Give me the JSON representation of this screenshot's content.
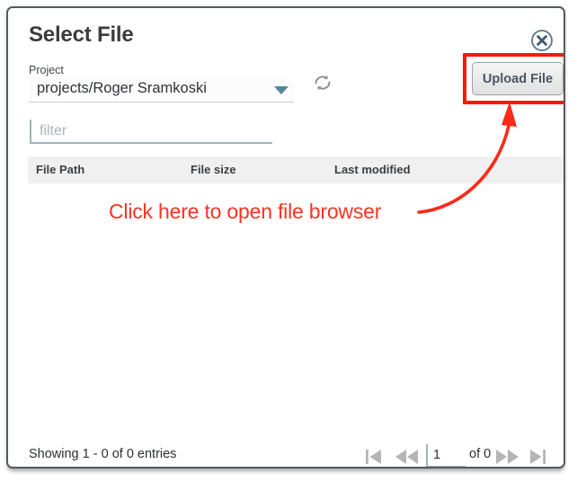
{
  "dialog": {
    "title": "Select File",
    "close_icon": "close-circle-icon"
  },
  "project": {
    "label": "Project",
    "selected": "projects/Roger Sramkoski",
    "caret_icon": "chevron-down-icon",
    "refresh_icon": "refresh-icon"
  },
  "upload": {
    "label": "Upload File",
    "highlight_color": "#fb1707"
  },
  "filter": {
    "placeholder": "filter",
    "value": ""
  },
  "table": {
    "columns": [
      "File Path",
      "File size",
      "Last modified"
    ],
    "rows": []
  },
  "footer": {
    "showing": "Showing 1 - 0 of 0 entries",
    "page_value": "1",
    "of_label": "of 0",
    "first_icon": "page-first-icon",
    "prev_icon": "page-prev-icon",
    "next_icon": "page-next-icon",
    "last_icon": "page-last-icon"
  },
  "annotation": {
    "text": "Click here to open file browser",
    "color": "#fb3322",
    "arrow_icon": "curved-arrow-icon"
  }
}
